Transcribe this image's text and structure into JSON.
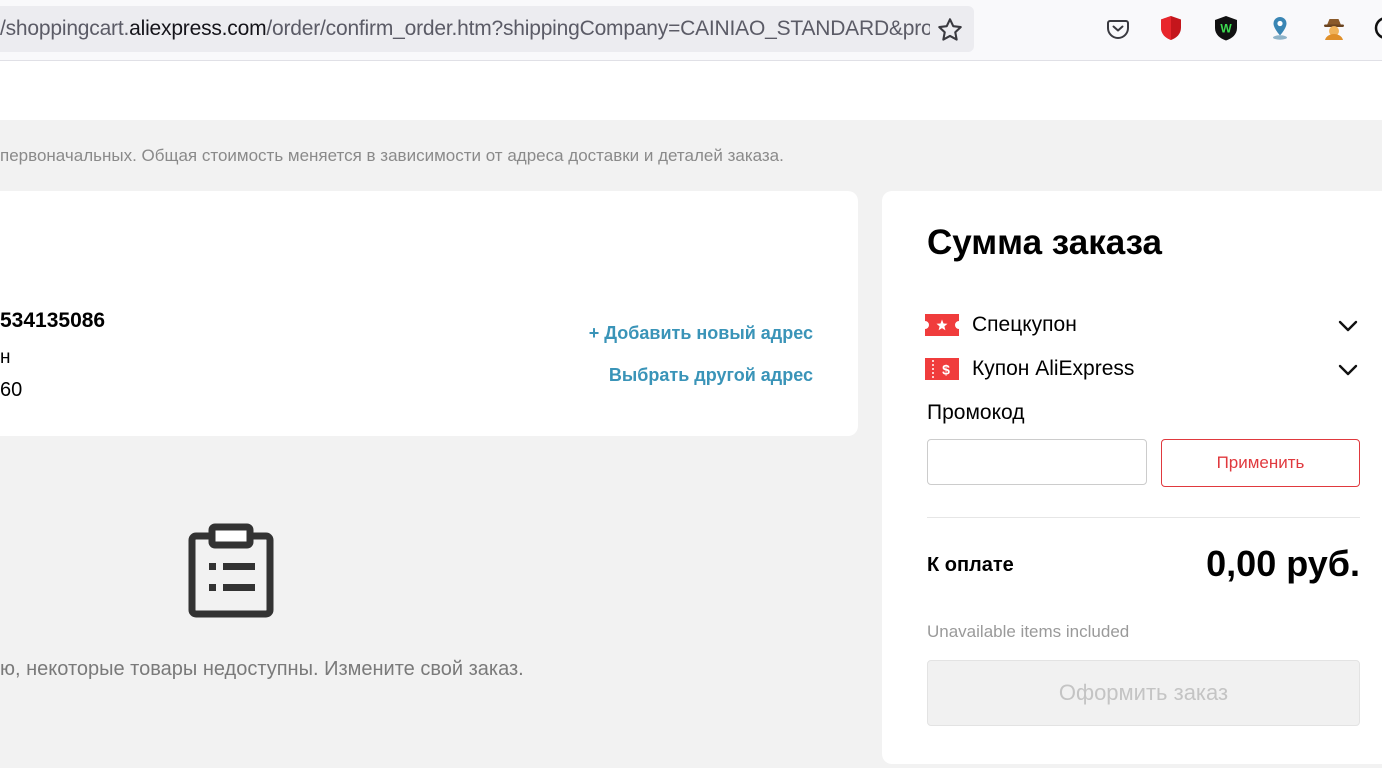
{
  "browser": {
    "url_prefix": "/shoppingcart.",
    "url_host": "aliexpress.com",
    "url_rest": "/order/confirm_order.htm?shippingCompany=CAINIAO_STANDARD&pro",
    "icons": [
      "bookmark-star-icon",
      "pocket-icon",
      "ublock-shield-icon",
      "w-extension-icon",
      "location-pin-extension-icon",
      "spy-extension-icon",
      "extension-edge-icon"
    ]
  },
  "notice": {
    "text": "первоначальных. Общая стоимость меняется в зависимости от адреса доставки и деталей заказа."
  },
  "address": {
    "phone": "534135086",
    "line2": "н",
    "line3": "60",
    "add_new_label": "+ Добавить новый адрес",
    "choose_other_label": "Выбрать другой адрес"
  },
  "empty_state": {
    "icon": "clipboard-list-icon",
    "text": "ю, некоторые товары недоступны. Измените свой заказ."
  },
  "summary": {
    "title": "Сумма заказа",
    "special_coupon_label": "Спецкупон",
    "ali_coupon_label": "Купон AliExpress",
    "promo_label": "Промокод",
    "promo_value": "",
    "promo_placeholder": "",
    "apply_label": "Применить",
    "to_pay_label": "К оплате",
    "to_pay_amount": "0,00 руб.",
    "unavailable_note": "Unavailable items included",
    "checkout_label": "Оформить заказ"
  },
  "colors": {
    "accent_red": "#e0393e",
    "link_blue": "#3a94b8",
    "page_bg": "#f2f2f2"
  }
}
